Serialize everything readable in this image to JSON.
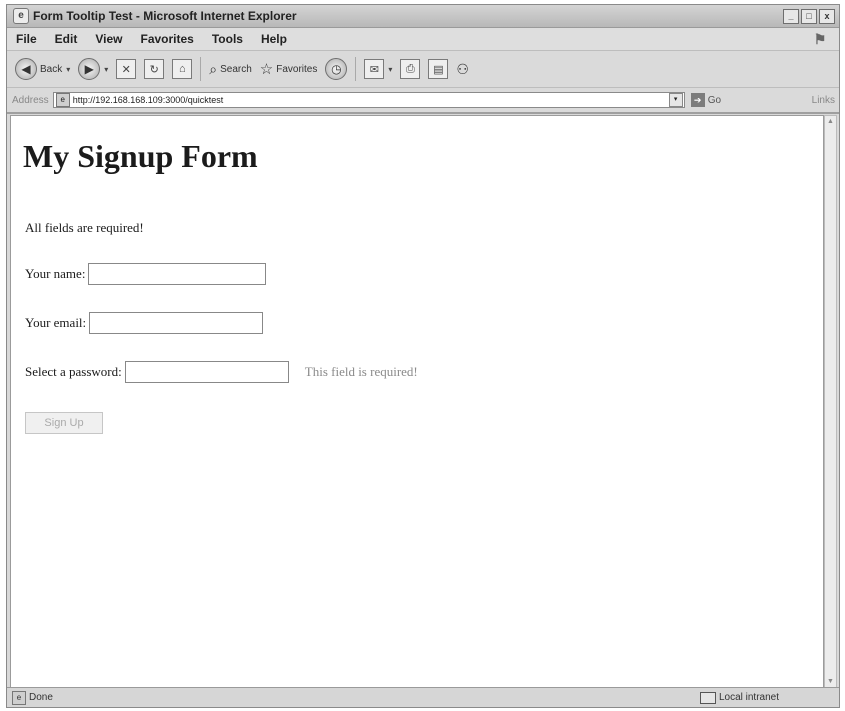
{
  "window": {
    "title": "Form Tooltip Test - Microsoft Internet Explorer"
  },
  "menu": [
    "File",
    "Edit",
    "View",
    "Favorites",
    "Tools",
    "Help"
  ],
  "toolbar": {
    "back_label": "Back",
    "search_label": "Search",
    "favorites_label": "Favorites"
  },
  "address": {
    "label": "Address",
    "url": "http://192.168.168.109:3000/quicktest",
    "go_label": "Go",
    "links_label": "Links"
  },
  "page": {
    "heading": "My Signup Form",
    "note": "All fields are required!",
    "name_label": "Your name:",
    "name_value": "",
    "email_label": "Your email:",
    "email_value": "",
    "password_label": "Select a password:",
    "password_value": "",
    "password_error": "This field is required!",
    "submit_label": "Sign Up"
  },
  "status": {
    "text": "Done",
    "zone": "Local intranet"
  }
}
